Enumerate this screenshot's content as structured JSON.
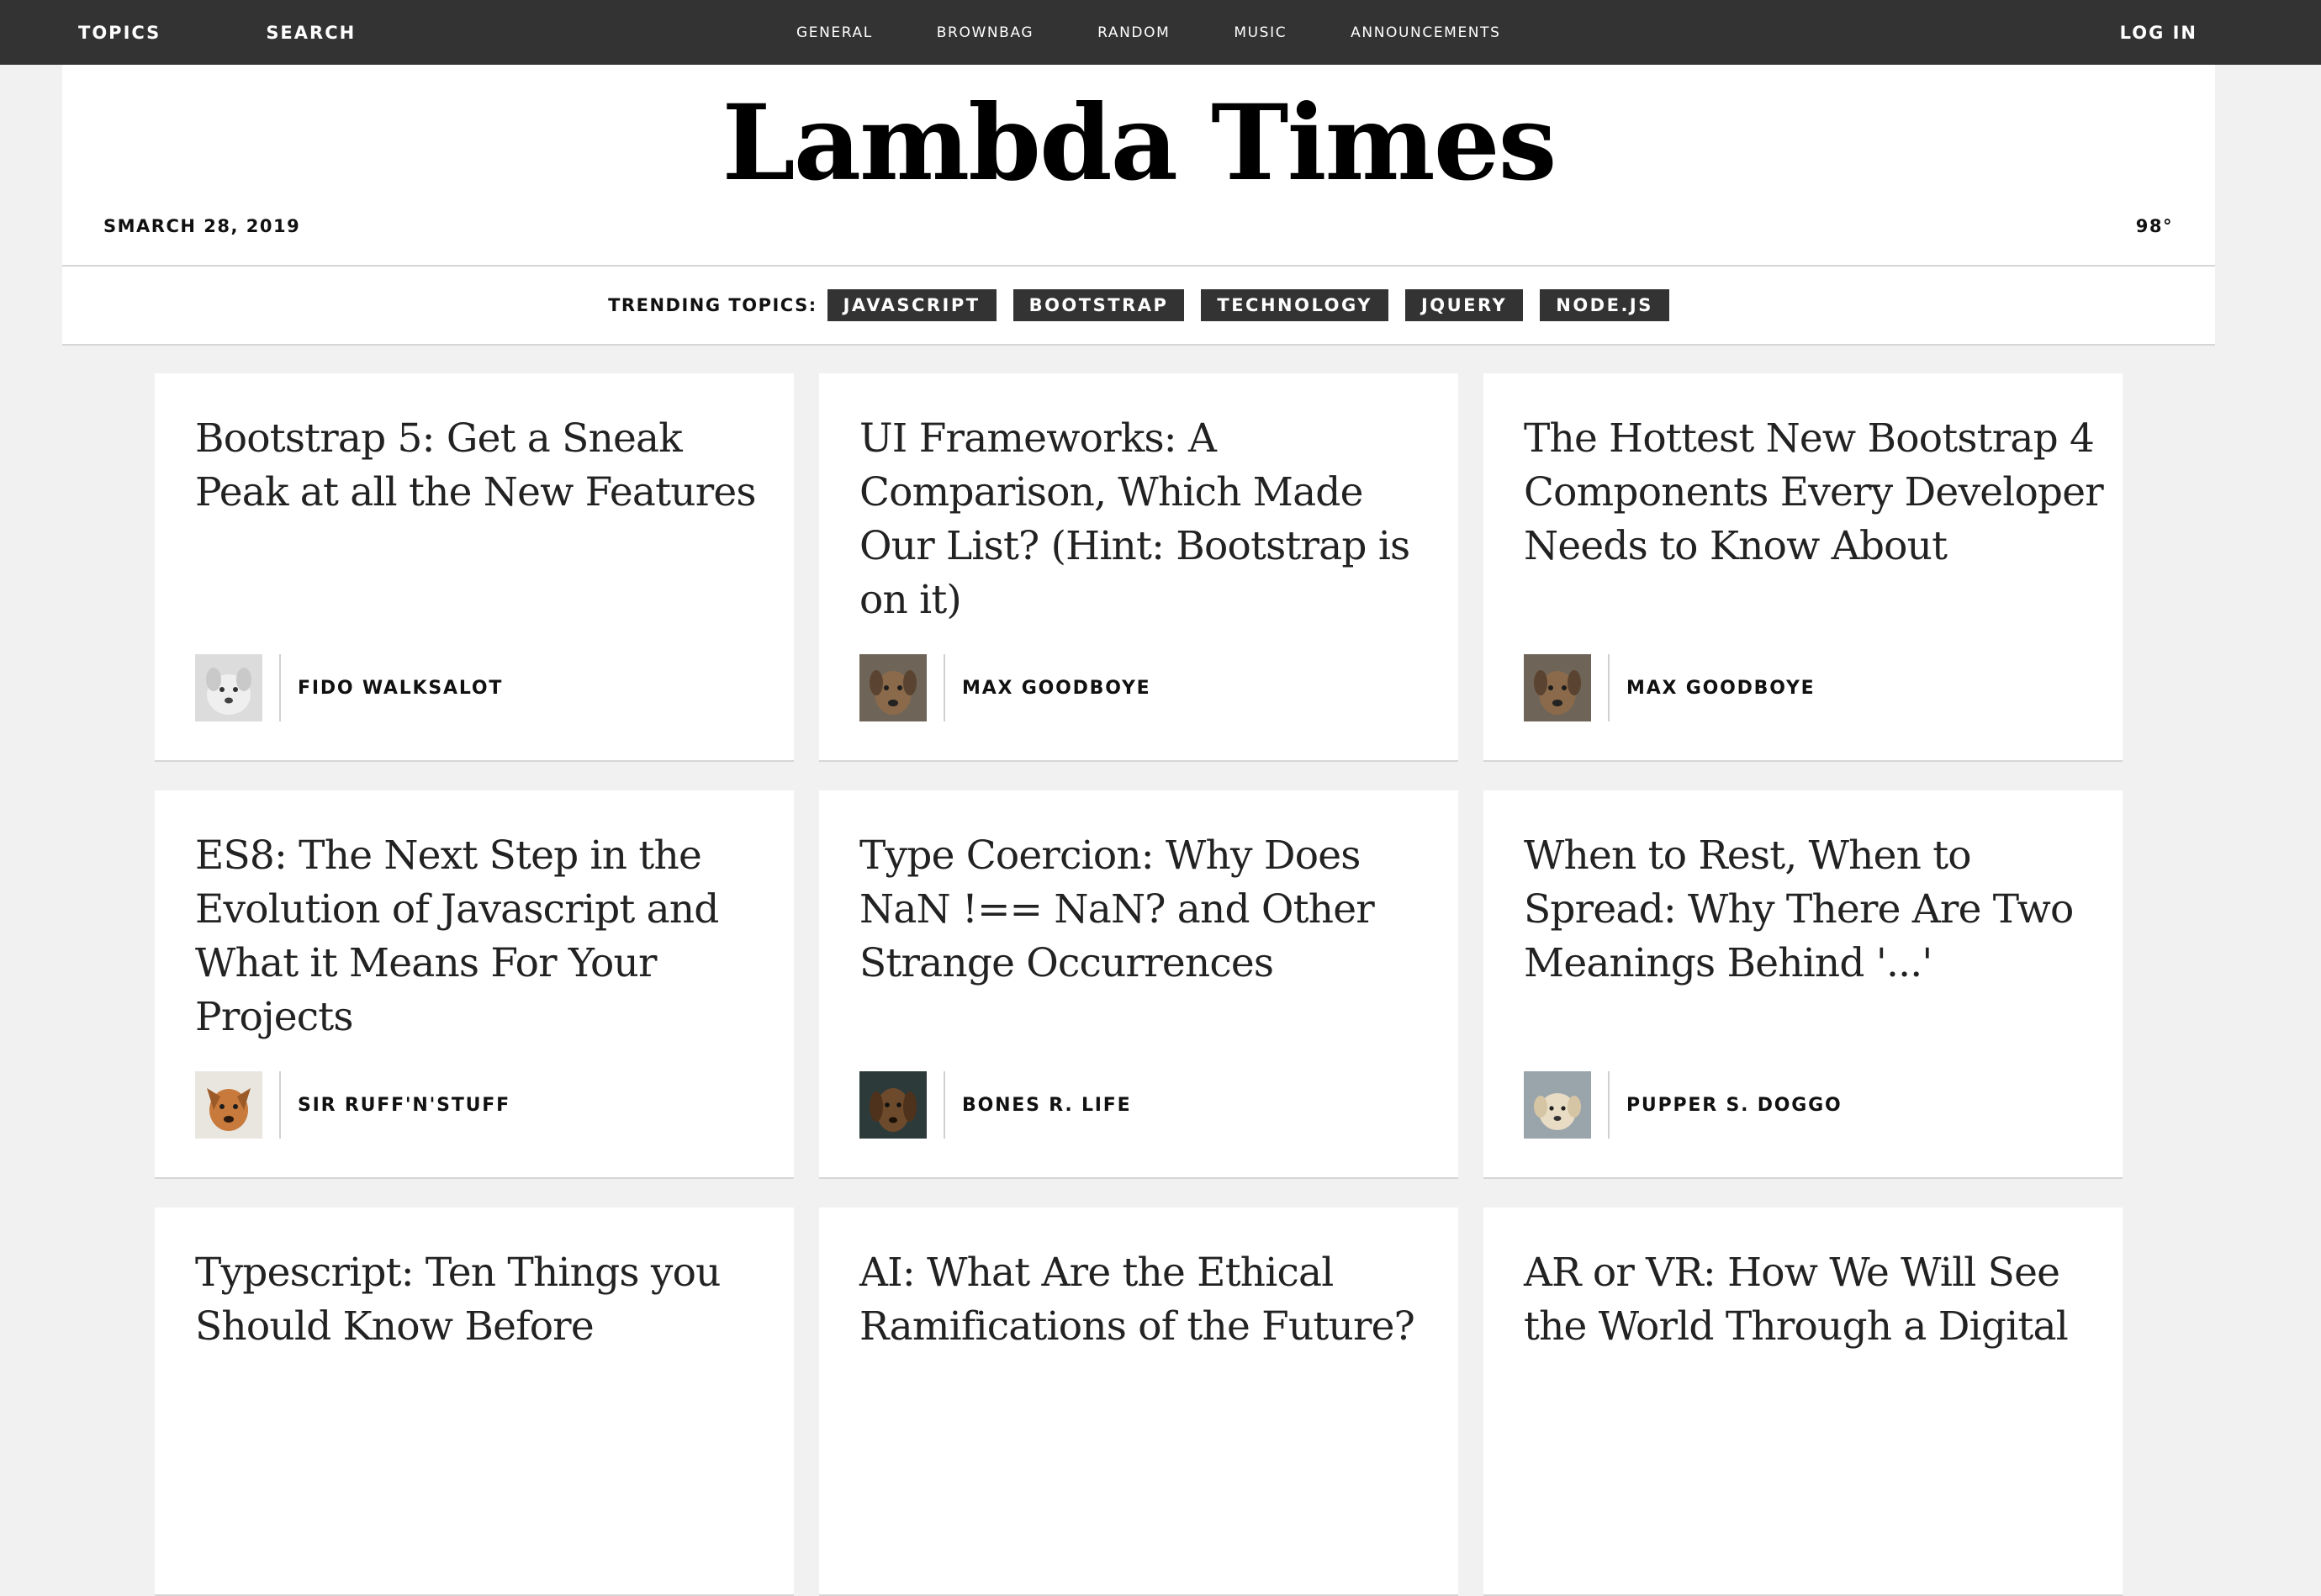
{
  "nav": {
    "left": [
      "TOPICS",
      "SEARCH"
    ],
    "tabs": [
      "GENERAL",
      "BROWNBAG",
      "RANDOM",
      "MUSIC",
      "ANNOUNCEMENTS"
    ],
    "login": "LOG IN"
  },
  "header": {
    "title": "Lambda Times",
    "date": "SMARCH 28, 2019",
    "temperature": "98°"
  },
  "trending": {
    "label": "TRENDING TOPICS:",
    "tags": [
      "JAVASCRIPT",
      "BOOTSTRAP",
      "TECHNOLOGY",
      "JQUERY",
      "NODE.JS"
    ]
  },
  "articles": [
    {
      "headline": "Bootstrap 5: Get a Sneak Peak at all the New Features",
      "author": "FIDO WALKSALOT",
      "avatar_icon": "dog-avatar-icon"
    },
    {
      "headline": "UI Frameworks: A Comparison, Which Made Our List? (Hint: Bootstrap is on it)",
      "author": "MAX GOODBOYE",
      "avatar_icon": "dog-avatar-icon"
    },
    {
      "headline": "The Hottest New Bootstrap 4 Components Every Developer Needs to Know About",
      "author": "MAX GOODBOYE",
      "avatar_icon": "dog-avatar-icon"
    },
    {
      "headline": "ES8: The Next Step in the Evolution of Javascript and What it Means For Your Projects",
      "author": "SIR RUFF'N'STUFF",
      "avatar_icon": "dog-avatar-icon"
    },
    {
      "headline": "Type Coercion: Why Does NaN !== NaN? and Other Strange Occurrences",
      "author": "BONES R. LIFE",
      "avatar_icon": "dog-avatar-icon"
    },
    {
      "headline": "When to Rest, When to Spread: Why There Are Two Meanings Behind '...'",
      "author": "PUPPER S. DOGGO",
      "avatar_icon": "dog-avatar-icon"
    },
    {
      "headline": "Typescript: Ten Things you Should Know Before",
      "author": "",
      "avatar_icon": ""
    },
    {
      "headline": "AI: What Are the Ethical Ramifications of the Future?",
      "author": "",
      "avatar_icon": ""
    },
    {
      "headline": "AR or VR: How We Will See the World Through a Digital",
      "author": "",
      "avatar_icon": ""
    }
  ],
  "colors": {
    "topbar": "#333333",
    "page_background": "#f1f1f1",
    "tag_background": "#333333",
    "card_background": "#ffffff"
  }
}
